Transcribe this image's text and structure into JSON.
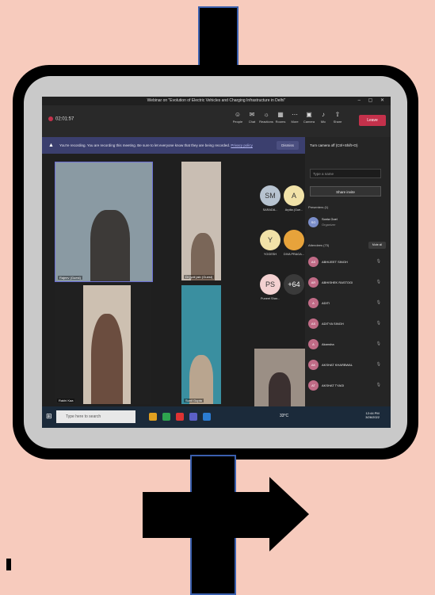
{
  "window": {
    "title": "Webinar on \"Evolution of Electric Vehicles and Charging Infrastructure in Delhi\"",
    "controls": "–  ▢  ✕"
  },
  "meeting": {
    "timer": "02:01:57"
  },
  "toolbar": [
    {
      "label": "People",
      "icon": "people-icon"
    },
    {
      "label": "Chat",
      "icon": "chat-icon"
    },
    {
      "label": "Reactions",
      "icon": "reactions-icon"
    },
    {
      "label": "Rooms",
      "icon": "rooms-icon"
    },
    {
      "label": "More",
      "icon": "more-icon"
    },
    {
      "label": "Camera",
      "icon": "camera-icon"
    },
    {
      "label": "Mic",
      "icon": "mic-icon"
    },
    {
      "label": "Share",
      "icon": "share-icon"
    }
  ],
  "leave_label": "Leave",
  "banner": {
    "text": "You're recording. You are recording this meeting. Be sure to let everyone know that they are being recorded.",
    "link": "Privacy policy",
    "dismiss": "Dismiss"
  },
  "tiles": {
    "t1": "Rajeev (Guest)",
    "t2": "Dr jyoti jain (Guest)",
    "t3": "Rakhi Kaa",
    "t4": "Sunil Gupta"
  },
  "avatars": [
    {
      "initials": "SM",
      "name": "SARADA..."
    },
    {
      "initials": "A",
      "name": "Arpita (Gue..."
    },
    {
      "initials": "Y",
      "name": "YOGESH"
    },
    {
      "initials": "",
      "name": "DIVA PRAGA..."
    },
    {
      "initials": "PS",
      "name": "Puneet Shar..."
    },
    {
      "initials": "+64",
      "name": ""
    }
  ],
  "panel": {
    "header": "Turn camera off (Ctrl+Shift+O)",
    "search_placeholder": "Type a name",
    "share_invite": "Share invite",
    "presenters": "Presenters (1)",
    "organizer_name": "Sonia Goel",
    "organizer_role": "Organizer",
    "attendees": "Attendees (73)",
    "mute_all": "Mute all",
    "people": [
      "ABHIJEET SINGH",
      "ABHISHEK RASTOGI",
      "ADITI",
      "ADITYA SINGH",
      "Akansha",
      "AKSHAT KHARBWAL",
      "AKSHAT TYAGI"
    ]
  },
  "taskbar": {
    "search_placeholder": "Type here to search",
    "time": "12:44 PM",
    "date": "3/26/2022",
    "weather": "33°C"
  },
  "colors": {
    "background": "#f7cbbd",
    "leave": "#c4314b",
    "banner": "#3b3f6e"
  }
}
